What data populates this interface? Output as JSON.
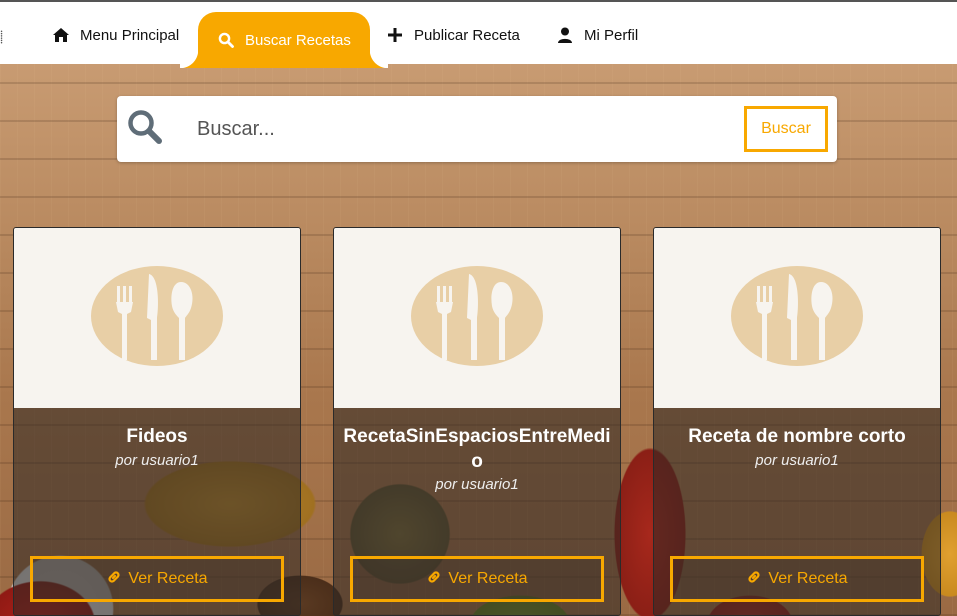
{
  "nav": {
    "items": [
      {
        "label": "Menu Principal",
        "icon": "home-icon",
        "active": false
      },
      {
        "label": "Buscar Recetas",
        "icon": "search-icon",
        "active": true
      },
      {
        "label": "Publicar Receta",
        "icon": "plus-icon",
        "active": false
      },
      {
        "label": "Mi Perfil",
        "icon": "user-icon",
        "active": false
      }
    ]
  },
  "search": {
    "placeholder": "Buscar...",
    "button_label": "Buscar"
  },
  "recipes": [
    {
      "title": "Fideos",
      "author": "por usuario1",
      "button_label": "Ver Receta"
    },
    {
      "title": "RecetaSinEspaciosEntreMedio",
      "author": "por usuario1",
      "button_label": "Ver Receta"
    },
    {
      "title": "Receta de nombre corto",
      "author": "por usuario1",
      "button_label": "Ver Receta"
    }
  ],
  "colors": {
    "accent": "#f8a800",
    "placeholder_icon": "#e8cfa6",
    "card_image_bg": "#f7f4ef"
  }
}
